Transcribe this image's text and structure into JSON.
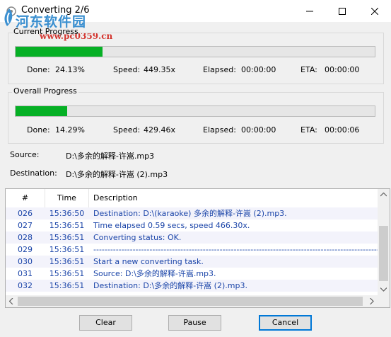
{
  "window": {
    "title": "Converting 2/6"
  },
  "watermark": {
    "site_name": "河东软件园",
    "url": "www.pc0359.cn"
  },
  "current_progress": {
    "label": "Current Progress",
    "fraction": 0.2413,
    "done_label": "Done:",
    "done_value": "24.13%",
    "speed_label": "Speed:",
    "speed_value": "449.35x",
    "elapsed_label": "Elapsed:",
    "elapsed_value": "00:00:00",
    "eta_label": "ETA:",
    "eta_value": "00:00:00"
  },
  "overall_progress": {
    "label": "Overall Progress",
    "fraction": 0.1429,
    "done_label": "Done:",
    "done_value": "14.29%",
    "speed_label": "Speed:",
    "speed_value": "429.46x",
    "elapsed_label": "Elapsed:",
    "elapsed_value": "00:00:00",
    "eta_label": "ETA:",
    "eta_value": "00:00:06"
  },
  "files": {
    "source_label": "Source:",
    "source_value": "D:\\多余的解释-许嵩.mp3",
    "destination_label": "Destination:",
    "destination_value": "D:\\多余的解释-许嵩 (2).mp3"
  },
  "log": {
    "columns": [
      "#",
      "Time",
      "Description"
    ],
    "rows": [
      {
        "num": "026",
        "time": "15:36:50",
        "desc": "Destination: D:\\(karaoke) 多余的解释-许嵩 (2).mp3."
      },
      {
        "num": "027",
        "time": "15:36:51",
        "desc": "Time elapsed 0.59 secs, speed 466.30x."
      },
      {
        "num": "028",
        "time": "15:36:51",
        "desc": "Converting status: OK."
      },
      {
        "num": "029",
        "time": "15:36:51",
        "desc": "------------------------------------------------------------------------------------------------------------------------------------------"
      },
      {
        "num": "030",
        "time": "15:36:51",
        "desc": "Start a new converting task."
      },
      {
        "num": "031",
        "time": "15:36:51",
        "desc": "Source:  D:\\多余的解释-许嵩.mp3."
      },
      {
        "num": "032",
        "time": "15:36:51",
        "desc": "Destination: D:\\多余的解释-许嵩 (2).mp3."
      }
    ]
  },
  "buttons": {
    "clear": "Clear",
    "pause": "Pause",
    "cancel": "Cancel"
  },
  "colors": {
    "progress_fill": "#06b025",
    "log_text": "#1a44a8",
    "focus_border": "#0078d7"
  }
}
